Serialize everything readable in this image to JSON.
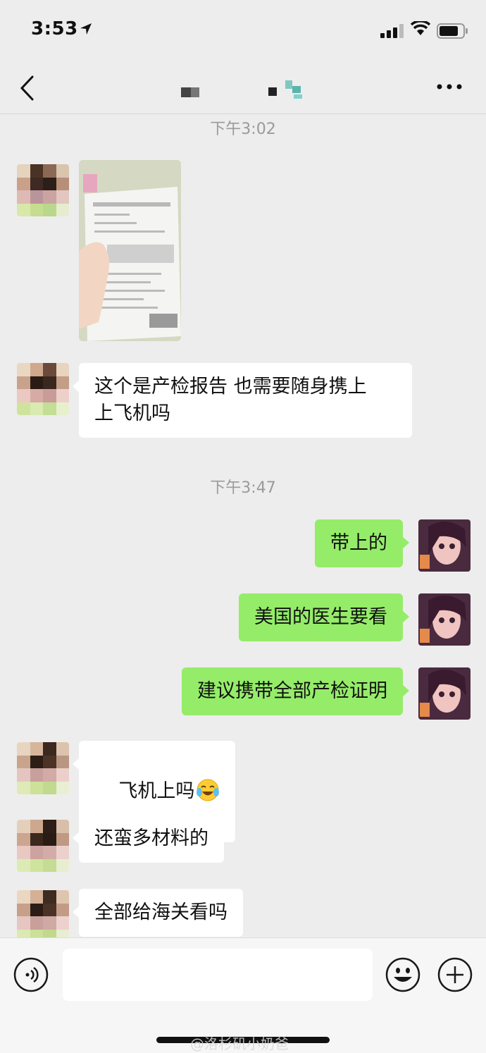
{
  "status_bar": {
    "time": "3:53"
  },
  "header": {
    "back_icon": "chevron-left-icon",
    "more_icon": "more-dots-icon"
  },
  "timestamps": [
    "下午3:02",
    "下午3:47"
  ],
  "messages": [
    {
      "side": "left",
      "type": "image"
    },
    {
      "side": "left",
      "text": "这个是产检报告 也需要随身携上\n上飞机吗"
    },
    {
      "side": "right",
      "text": "带上的"
    },
    {
      "side": "right",
      "text": "美国的医生要看"
    },
    {
      "side": "right",
      "text": "建议携带全部产检证明"
    },
    {
      "side": "left",
      "text": "飞机上吗",
      "emoji": "crying-laughing-emoji"
    },
    {
      "side": "left",
      "text": "还蛮多材料的"
    },
    {
      "side": "left",
      "text": "全部给海关看吗"
    }
  ],
  "input_bar": {
    "voice_icon": "voice-icon",
    "emoji_icon": "smiley-icon",
    "plus_icon": "plus-icon",
    "placeholder": ""
  },
  "watermark": "@洛杉矶小奶爸",
  "colors": {
    "background": "#ededed",
    "sent_bubble": "#95ec69",
    "received_bubble": "#ffffff",
    "timestamp": "#9a9a9a"
  }
}
